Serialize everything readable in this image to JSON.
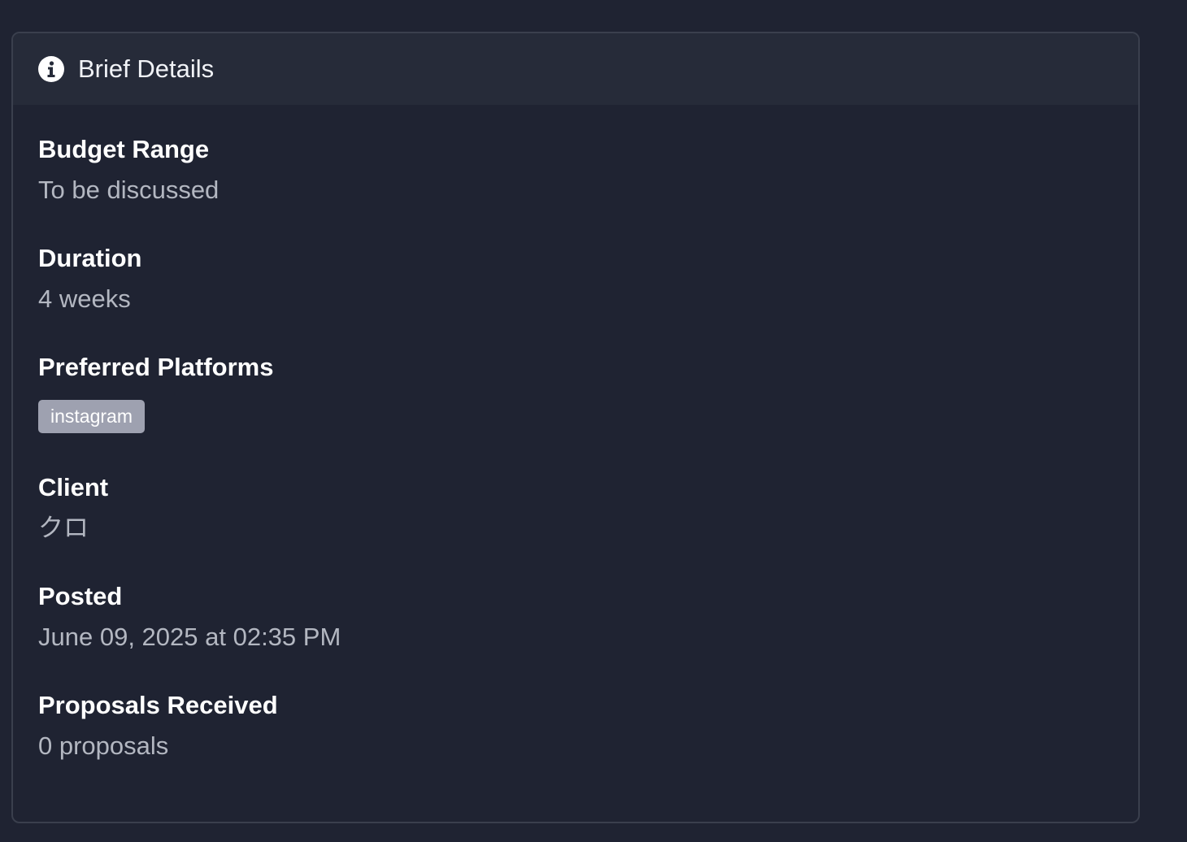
{
  "card": {
    "title": "Brief Details",
    "icon": "info-icon"
  },
  "fields": {
    "budget": {
      "label": "Budget Range",
      "value": "To be discussed"
    },
    "duration": {
      "label": "Duration",
      "value": "4 weeks"
    },
    "platforms": {
      "label": "Preferred Platforms",
      "tags": [
        "instagram"
      ]
    },
    "client": {
      "label": "Client",
      "value": "クロ"
    },
    "posted": {
      "label": "Posted",
      "value": "June 09, 2025 at 02:35 PM"
    },
    "proposals": {
      "label": "Proposals Received",
      "value": "0 proposals"
    }
  }
}
